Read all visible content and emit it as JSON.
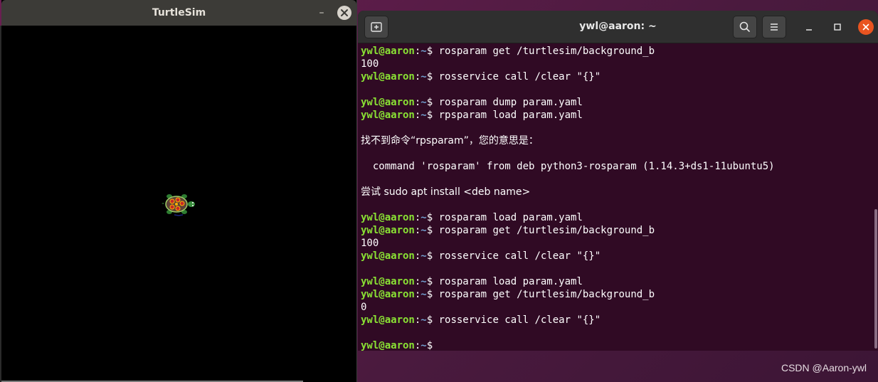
{
  "turtlesim": {
    "title": "TurtleSim",
    "minimize_glyph": "–",
    "close_icon": "close-icon",
    "background_color": "#000000"
  },
  "terminal": {
    "title": "ywl@aaron: ~",
    "new_tab_icon": "new-tab-icon",
    "search_icon": "search-icon",
    "menu_icon": "hamburger-menu-icon",
    "background_color": "#300a24",
    "prompt": {
      "user_host": "ywl@aaron",
      "separator": ":",
      "path": "~",
      "symbol": "$ "
    },
    "lines": [
      {
        "type": "cmd",
        "text": "rosparam get /turtlesim/background_b"
      },
      {
        "type": "out",
        "text": "100"
      },
      {
        "type": "cmd",
        "text": "rosservice call /clear \"{}\""
      },
      {
        "type": "blank",
        "text": ""
      },
      {
        "type": "cmd",
        "text": "rosparam dump param.yaml"
      },
      {
        "type": "cmd",
        "text": "rpsparam load param.yaml"
      },
      {
        "type": "blank",
        "text": ""
      },
      {
        "type": "out",
        "text": "找不到命令“rpsparam”，您的意思是："
      },
      {
        "type": "blank",
        "text": ""
      },
      {
        "type": "out",
        "text": "  command 'rosparam' from deb python3-rosparam (1.14.3+ds1-11ubuntu5)"
      },
      {
        "type": "blank",
        "text": ""
      },
      {
        "type": "out",
        "text": "尝试 sudo apt install <deb name>"
      },
      {
        "type": "blank",
        "text": ""
      },
      {
        "type": "cmd",
        "text": "rosparam load param.yaml"
      },
      {
        "type": "cmd",
        "text": "rosparam get /turtlesim/background_b"
      },
      {
        "type": "out",
        "text": "100"
      },
      {
        "type": "cmd",
        "text": "rosservice call /clear \"{}\""
      },
      {
        "type": "blank",
        "text": ""
      },
      {
        "type": "cmd",
        "text": "rosparam load param.yaml"
      },
      {
        "type": "cmd",
        "text": "rosparam get /turtlesim/background_b"
      },
      {
        "type": "out",
        "text": "0"
      },
      {
        "type": "cmd",
        "text": "rosservice call /clear \"{}\""
      },
      {
        "type": "blank",
        "text": ""
      },
      {
        "type": "cmd",
        "text": ""
      }
    ]
  },
  "watermark": "CSDN @Aaron-ywl",
  "colors": {
    "prompt_user": "#8ae234",
    "prompt_path": "#729fcf",
    "ubuntu_orange": "#e95420",
    "desktop": "#5a1f48"
  }
}
